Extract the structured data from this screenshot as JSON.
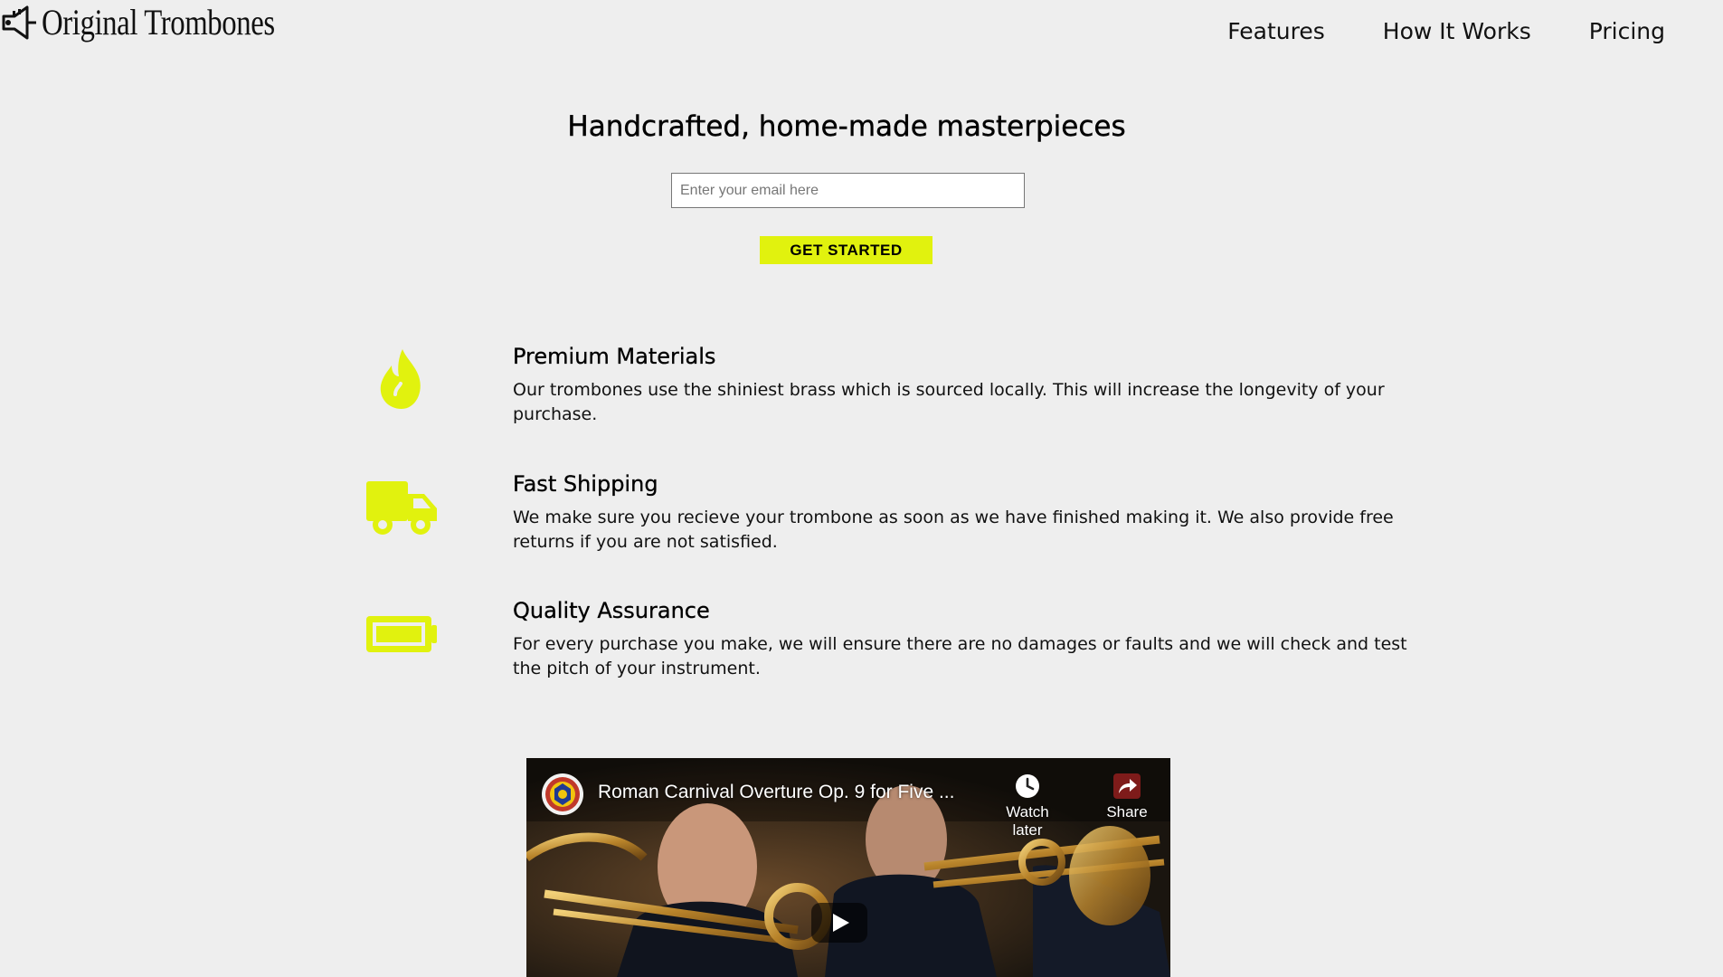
{
  "header": {
    "logo_text": "Original Trombones",
    "logo_icon": "trumpet-icon",
    "nav": [
      {
        "label": "Features"
      },
      {
        "label": "How It Works"
      },
      {
        "label": "Pricing"
      }
    ]
  },
  "hero": {
    "title": "Handcrafted, home-made masterpieces",
    "email_placeholder": "Enter your email here",
    "email_value": "",
    "cta_label": "GET STARTED"
  },
  "features": [
    {
      "icon": "fire-icon",
      "title": "Premium Materials",
      "text": "Our trombones use the shiniest brass which is sourced locally. This will increase the longevity of your purchase."
    },
    {
      "icon": "truck-icon",
      "title": "Fast Shipping",
      "text": "We make sure you recieve your trombone as soon as we have finished making it. We also provide free returns if you are not satisfied."
    },
    {
      "icon": "battery-icon",
      "title": "Quality Assurance",
      "text": "For every purchase you make, we will ensure there are no damages or faults and we will check and test the pitch of your instrument."
    }
  ],
  "video": {
    "title": "Roman Carnival Overture Op. 9 for Five ...",
    "watch_later_label": "Watch later",
    "share_label": "Share"
  },
  "colors": {
    "accent": "#e1f20e",
    "background": "#eeeeee",
    "text": "#111111"
  }
}
